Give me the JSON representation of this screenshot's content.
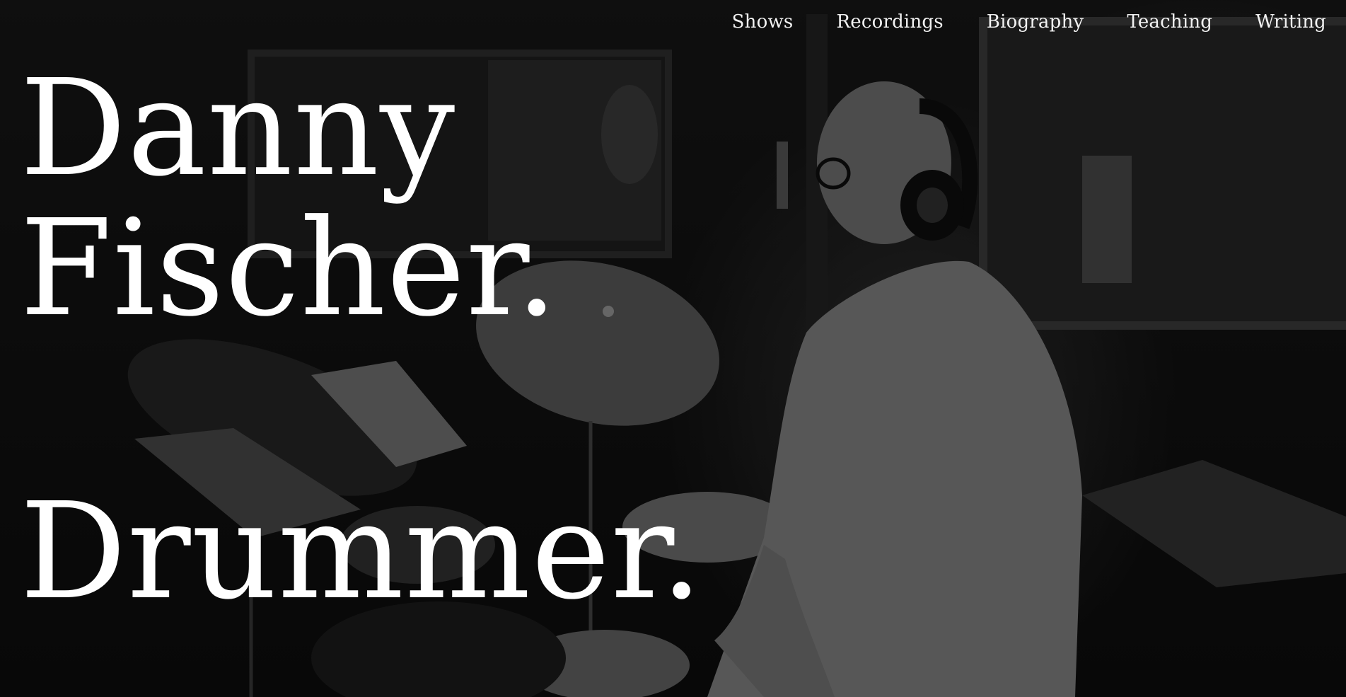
{
  "nav": {
    "items": [
      {
        "label": "Shows"
      },
      {
        "label": "Recordings"
      },
      {
        "label": "Biography"
      },
      {
        "label": "Teaching"
      },
      {
        "label": "Writing"
      }
    ]
  },
  "hero": {
    "name_line_1": "Danny",
    "name_line_2": "Fischer.",
    "role": "Drummer.",
    "background_image": "drummer-in-studio-photo"
  },
  "colors": {
    "text": "#ffffff",
    "overlay": "#151515"
  }
}
